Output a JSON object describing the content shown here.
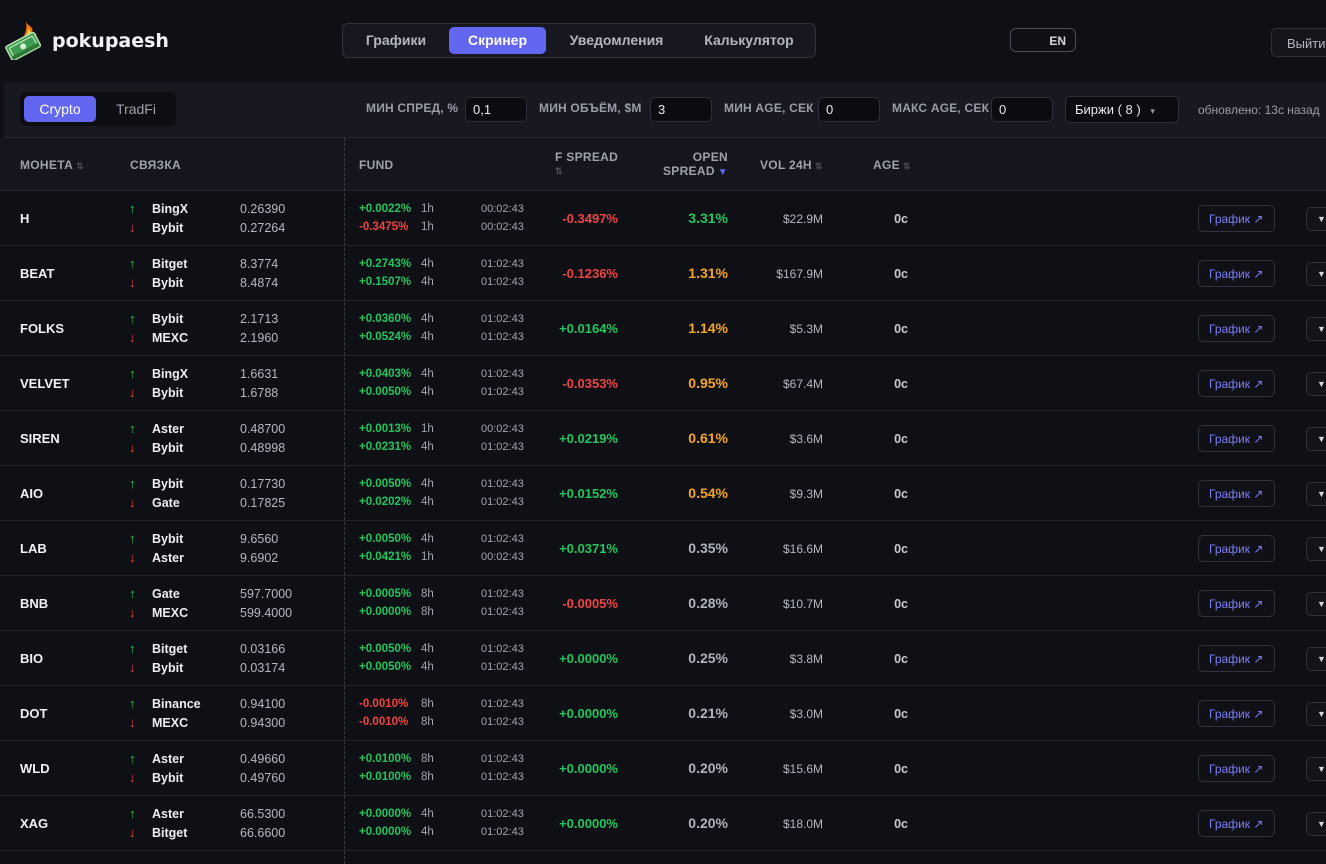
{
  "app": {
    "brand": "pokupaesh",
    "nav": [
      {
        "label": "Графики"
      },
      {
        "label": "Скринер"
      },
      {
        "label": "Уведомления"
      },
      {
        "label": "Калькулятор"
      }
    ],
    "active_nav": "Скринер",
    "lang": "EN",
    "logout": "Выйти"
  },
  "filters": {
    "market_tabs": [
      "Crypto",
      "TradFi"
    ],
    "active_market": "Crypto",
    "min_spread_label": "МИН СПРЕД, %",
    "min_spread_value": "0,1",
    "min_volume_label": "МИН ОБЪЁМ, $M",
    "min_volume_value": "3",
    "min_age_label": "МИН AGE, СЕК",
    "min_age_value": "0",
    "max_age_label": "МАКС AGE, СЕК",
    "max_age_value": "0",
    "exchanges_label": "Биржи ( 8 )",
    "exchanges_caret": "▾",
    "updated": "обновлено: 13с назад"
  },
  "table": {
    "headers": {
      "coin": "МОНЕТА",
      "pair": "СВЯЗКА",
      "fund": "FUND",
      "f_spread": "F SPREAD",
      "open_spread_1": "OPEN",
      "open_spread_2": "SPREAD",
      "vol": "VOL 24H",
      "age": "AGE"
    },
    "sort_icon": "⇅",
    "sort_active_icon": "▼",
    "up_arrow": "↑",
    "down_arrow": "↓",
    "chart_button": "График ↗",
    "row_menu": "▼",
    "rows": [
      {
        "coin": "H",
        "ex1": "BingX",
        "p1": "0.26390",
        "ex2": "Bybit",
        "p2": "0.27264",
        "f1": "+0.0022%",
        "i1": "1h",
        "t1": "00:02:43",
        "f2": "-0.3475%",
        "i2": "1h",
        "t2": "00:02:43",
        "fspread": "-0.3497%",
        "ospread": "3.31%",
        "vol": "$22.9M",
        "age": "0с"
      },
      {
        "coin": "BEAT",
        "ex1": "Bitget",
        "p1": "8.3774",
        "ex2": "Bybit",
        "p2": "8.4874",
        "f1": "+0.2743%",
        "i1": "4h",
        "t1": "01:02:43",
        "f2": "+0.1507%",
        "i2": "4h",
        "t2": "01:02:43",
        "fspread": "-0.1236%",
        "ospread": "1.31%",
        "vol": "$167.9M",
        "age": "0с"
      },
      {
        "coin": "FOLKS",
        "ex1": "Bybit",
        "p1": "2.1713",
        "ex2": "MEXC",
        "p2": "2.1960",
        "f1": "+0.0360%",
        "i1": "4h",
        "t1": "01:02:43",
        "f2": "+0.0524%",
        "i2": "4h",
        "t2": "01:02:43",
        "fspread": "+0.0164%",
        "ospread": "1.14%",
        "vol": "$5.3M",
        "age": "0с"
      },
      {
        "coin": "VELVET",
        "ex1": "BingX",
        "p1": "1.6631",
        "ex2": "Bybit",
        "p2": "1.6788",
        "f1": "+0.0403%",
        "i1": "4h",
        "t1": "01:02:43",
        "f2": "+0.0050%",
        "i2": "4h",
        "t2": "01:02:43",
        "fspread": "-0.0353%",
        "ospread": "0.95%",
        "vol": "$67.4M",
        "age": "0с"
      },
      {
        "coin": "SIREN",
        "ex1": "Aster",
        "p1": "0.48700",
        "ex2": "Bybit",
        "p2": "0.48998",
        "f1": "+0.0013%",
        "i1": "1h",
        "t1": "00:02:43",
        "f2": "+0.0231%",
        "i2": "4h",
        "t2": "01:02:43",
        "fspread": "+0.0219%",
        "ospread": "0.61%",
        "vol": "$3.6M",
        "age": "0с"
      },
      {
        "coin": "AIO",
        "ex1": "Bybit",
        "p1": "0.17730",
        "ex2": "Gate",
        "p2": "0.17825",
        "f1": "+0.0050%",
        "i1": "4h",
        "t1": "01:02:43",
        "f2": "+0.0202%",
        "i2": "4h",
        "t2": "01:02:43",
        "fspread": "+0.0152%",
        "ospread": "0.54%",
        "vol": "$9.3M",
        "age": "0с"
      },
      {
        "coin": "LAB",
        "ex1": "Bybit",
        "p1": "9.6560",
        "ex2": "Aster",
        "p2": "9.6902",
        "f1": "+0.0050%",
        "i1": "4h",
        "t1": "01:02:43",
        "f2": "+0.0421%",
        "i2": "1h",
        "t2": "00:02:43",
        "fspread": "+0.0371%",
        "ospread": "0.35%",
        "vol": "$16.6M",
        "age": "0с"
      },
      {
        "coin": "BNB",
        "ex1": "Gate",
        "p1": "597.7000",
        "ex2": "MEXC",
        "p2": "599.4000",
        "f1": "+0.0005%",
        "i1": "8h",
        "t1": "01:02:43",
        "f2": "+0.0000%",
        "i2": "8h",
        "t2": "01:02:43",
        "fspread": "-0.0005%",
        "ospread": "0.28%",
        "vol": "$10.7M",
        "age": "0с"
      },
      {
        "coin": "BIO",
        "ex1": "Bitget",
        "p1": "0.03166",
        "ex2": "Bybit",
        "p2": "0.03174",
        "f1": "+0.0050%",
        "i1": "4h",
        "t1": "01:02:43",
        "f2": "+0.0050%",
        "i2": "4h",
        "t2": "01:02:43",
        "fspread": "+0.0000%",
        "ospread": "0.25%",
        "vol": "$3.8M",
        "age": "0с"
      },
      {
        "coin": "DOT",
        "ex1": "Binance",
        "p1": "0.94100",
        "ex2": "MEXC",
        "p2": "0.94300",
        "f1": "-0.0010%",
        "i1": "8h",
        "t1": "01:02:43",
        "f2": "-0.0010%",
        "i2": "8h",
        "t2": "01:02:43",
        "fspread": "+0.0000%",
        "ospread": "0.21%",
        "vol": "$3.0M",
        "age": "0с"
      },
      {
        "coin": "WLD",
        "ex1": "Aster",
        "p1": "0.49660",
        "ex2": "Bybit",
        "p2": "0.49760",
        "f1": "+0.0100%",
        "i1": "8h",
        "t1": "01:02:43",
        "f2": "+0.0100%",
        "i2": "8h",
        "t2": "01:02:43",
        "fspread": "+0.0000%",
        "ospread": "0.20%",
        "vol": "$15.6M",
        "age": "0с"
      },
      {
        "coin": "XAG",
        "ex1": "Aster",
        "p1": "66.5300",
        "ex2": "Bitget",
        "p2": "66.6600",
        "f1": "+0.0000%",
        "i1": "4h",
        "t1": "01:02:43",
        "f2": "+0.0000%",
        "i2": "4h",
        "t2": "01:02:43",
        "fspread": "+0.0000%",
        "ospread": "0.20%",
        "vol": "$18.0M",
        "age": "0с"
      }
    ]
  },
  "colors": {
    "accent": "#6366f1",
    "positive": "#22c55e",
    "negative": "#ef4444",
    "open_spread_high": "#22c55e",
    "open_spread_mid": "#f5a623",
    "open_spread_low": "#b0b3bd"
  },
  "icons": {
    "logo": "money-stack-fire-icon",
    "sort": "sort-icon",
    "external": "external-link-icon",
    "caret": "chevron-down-icon"
  }
}
